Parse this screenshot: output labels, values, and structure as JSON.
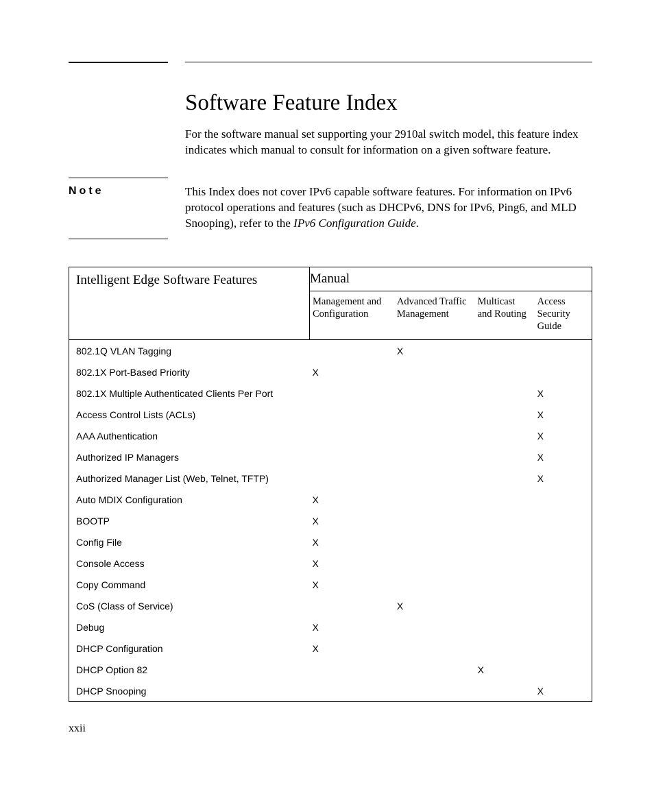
{
  "title": "Software Feature Index",
  "intro": "For the software manual set supporting your 2910al switch model, this feature index indicates which manual to consult for information on a given software feature.",
  "note_label": "Note",
  "note_body_pre": "This Index does not cover IPv6 capable software features. For information on IPv6 protocol operations and features (such as DHCPv6, DNS for IPv6, Ping6, and MLD Snooping), refer to the ",
  "note_body_ital": "IPv6 Configuration Guide",
  "note_body_post": ".",
  "table": {
    "left_header": "Intelligent Edge Software Features",
    "manual_header": "Manual",
    "columns": [
      "Management and Configuration",
      "Advanced Traffic Management",
      "Multicast and Routing",
      "Access Security Guide"
    ],
    "rows": [
      {
        "feature": "802.1Q VLAN Tagging",
        "marks": [
          "",
          "X",
          "",
          ""
        ]
      },
      {
        "feature": "802.1X Port-Based Priority",
        "marks": [
          "X",
          "",
          "",
          ""
        ]
      },
      {
        "feature": "802.1X Multiple Authenticated Clients Per Port",
        "marks": [
          "",
          "",
          "",
          "X"
        ]
      },
      {
        "feature": "Access Control Lists (ACLs)",
        "marks": [
          "",
          "",
          "",
          "X"
        ]
      },
      {
        "feature": "AAA Authentication",
        "marks": [
          "",
          "",
          "",
          "X"
        ]
      },
      {
        "feature": "Authorized IP Managers",
        "marks": [
          "",
          "",
          "",
          "X"
        ]
      },
      {
        "feature": "Authorized Manager List (Web, Telnet, TFTP)",
        "marks": [
          "",
          "",
          "",
          "X"
        ]
      },
      {
        "feature": "Auto MDIX Configuration",
        "marks": [
          "X",
          "",
          "",
          ""
        ]
      },
      {
        "feature": "BOOTP",
        "marks": [
          "X",
          "",
          "",
          ""
        ]
      },
      {
        "feature": "Config File",
        "marks": [
          "X",
          "",
          "",
          ""
        ]
      },
      {
        "feature": "Console Access",
        "marks": [
          "X",
          "",
          "",
          ""
        ]
      },
      {
        "feature": "Copy Command",
        "marks": [
          "X",
          "",
          "",
          ""
        ]
      },
      {
        "feature": "CoS (Class of Service)",
        "marks": [
          "",
          "X",
          "",
          ""
        ]
      },
      {
        "feature": "Debug",
        "marks": [
          "X",
          "",
          "",
          ""
        ]
      },
      {
        "feature": "DHCP Configuration",
        "marks": [
          "X",
          "",
          "",
          ""
        ]
      },
      {
        "feature": "DHCP Option 82",
        "marks": [
          "",
          "",
          "X",
          ""
        ]
      },
      {
        "feature": "DHCP Snooping",
        "marks": [
          "",
          "",
          "",
          "X"
        ]
      }
    ]
  },
  "page_number": "xxii"
}
